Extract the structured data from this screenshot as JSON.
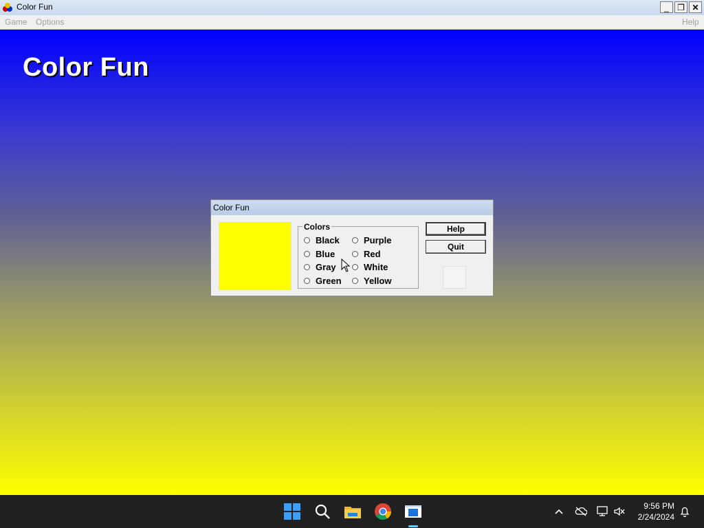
{
  "window": {
    "title": "Color Fun",
    "buttons": {
      "minimize": "_",
      "restore": "❐",
      "close": "✕"
    }
  },
  "menubar": {
    "game": "Game",
    "options": "Options",
    "help": "Help"
  },
  "canvas": {
    "title": "Color Fun"
  },
  "dialog": {
    "title": "Color Fun",
    "swatch_color": "#ffff00",
    "group_label": "Colors",
    "colors_left": [
      "Black",
      "Blue",
      "Gray",
      "Green"
    ],
    "colors_right": [
      "Purple",
      "Red",
      "White",
      "Yellow"
    ],
    "help_button": "Help",
    "quit_button": "Quit"
  },
  "taskbar": {
    "icons": [
      "windows-start-icon",
      "search-icon",
      "file-explorer-icon",
      "chrome-icon",
      "color-fun-app-icon"
    ],
    "tray": [
      "chevron-up-icon",
      "onedrive-icon",
      "network-icon",
      "volume-muted-icon"
    ],
    "time": "9:56 PM",
    "date": "2/24/2024"
  },
  "colors": {
    "gradient_top": "#0000ff",
    "gradient_bottom": "#ffff00",
    "taskbar": "#202020",
    "accent": "#60cdff"
  }
}
